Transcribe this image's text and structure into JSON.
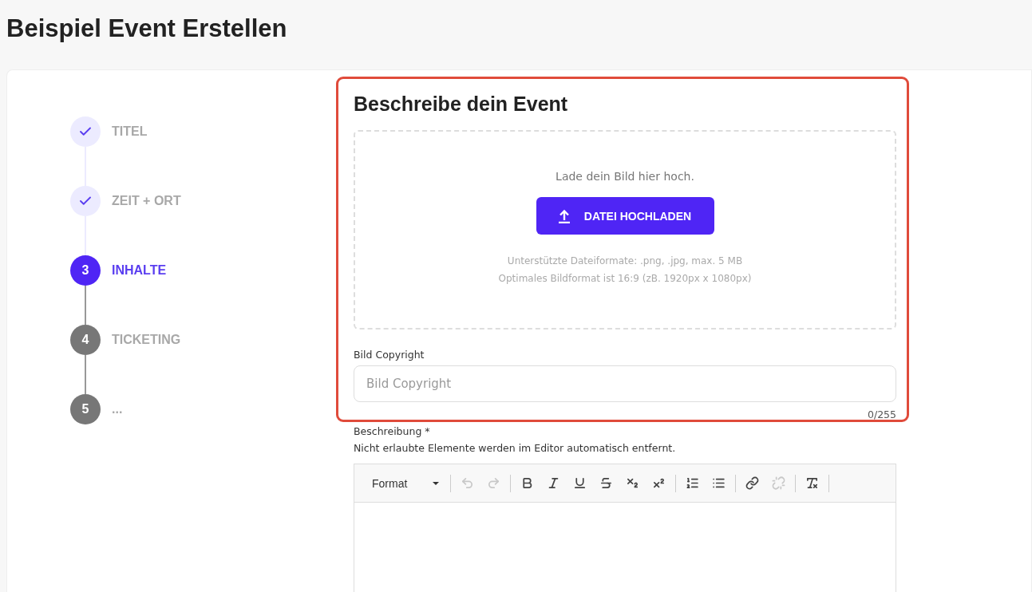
{
  "page_title": "Beispiel Event Erstellen",
  "steps": [
    {
      "label": "TITEL",
      "completed": true,
      "selected": false
    },
    {
      "label": "ZEIT + ORT",
      "completed": true,
      "selected": false
    },
    {
      "marker": "3",
      "label": "INHALTE",
      "completed": false,
      "selected": true
    },
    {
      "marker": "4",
      "label": "TICKETING",
      "completed": false,
      "selected": false
    },
    {
      "marker": "5",
      "label": "...",
      "completed": false,
      "selected": false
    }
  ],
  "section_title": "Beschreibe dein Event",
  "upload": {
    "prompt": "Lade dein Bild hier hoch.",
    "button": "DATEI HOCHLADEN",
    "hints": [
      "Unterstützte Dateiformate: .png, .jpg, max. 5 MB",
      "Optimales Bildformat ist 16:9 (zB. 1920px x 1080px)"
    ]
  },
  "copyright": {
    "label": "Bild Copyright",
    "placeholder": "Bild Copyright",
    "counter": "0/255"
  },
  "description": {
    "label": "Beschreibung *",
    "note": "Nicht erlaubte Elemente werden im Editor automatisch entfernt.",
    "format_label": "Format",
    "toolbar": [
      [
        {
          "kind": "undo",
          "disabled": true
        },
        {
          "kind": "redo",
          "disabled": true
        }
      ],
      [
        {
          "kind": "bold",
          "disabled": false
        },
        {
          "kind": "italic",
          "disabled": false
        },
        {
          "kind": "underline",
          "disabled": false
        },
        {
          "kind": "strike",
          "disabled": false
        },
        {
          "kind": "subscript",
          "disabled": false
        },
        {
          "kind": "superscript",
          "disabled": false
        }
      ],
      [
        {
          "kind": "ordered-list",
          "disabled": false
        },
        {
          "kind": "bullet-list",
          "disabled": false
        }
      ],
      [
        {
          "kind": "link",
          "disabled": false
        },
        {
          "kind": "unlink",
          "disabled": true
        }
      ],
      [
        {
          "kind": "clear-format",
          "disabled": false
        }
      ]
    ]
  },
  "highlight": {
    "shown": true
  }
}
